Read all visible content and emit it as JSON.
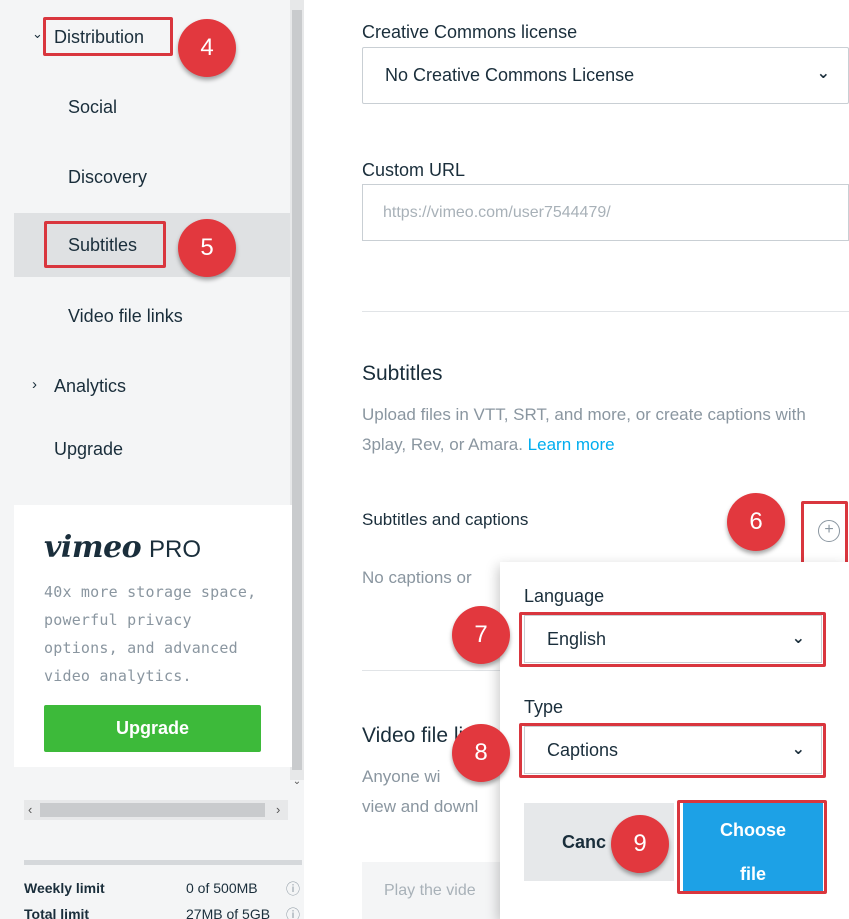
{
  "sidebar": {
    "nav": {
      "distribution": "Distribution",
      "social": "Social",
      "discovery": "Discovery",
      "subtitles": "Subtitles",
      "video_file_links": "Video file links",
      "analytics": "Analytics",
      "upgrade": "Upgrade"
    },
    "pro_card": {
      "logo": "vimeo",
      "tier": "PRO",
      "description": "40x more storage space, powerful privacy options, and advanced video analytics.",
      "button": "Upgrade"
    },
    "limits": [
      {
        "label": "Weekly limit",
        "value": "0 of 500MB"
      },
      {
        "label": "Total limit",
        "value": "27MB of 5GB"
      }
    ]
  },
  "main": {
    "license": {
      "label": "Creative Commons license",
      "value": "No Creative Commons License"
    },
    "custom_url": {
      "label": "Custom URL",
      "placeholder": "https://vimeo.com/user7544479/"
    },
    "subtitles": {
      "title": "Subtitles",
      "description": "Upload files in VTT, SRT, and more, or create captions with 3play, Rev, or Amara.",
      "learn_more": "Learn more",
      "list_label": "Subtitles and captions",
      "empty_text": "No captions or"
    },
    "video_file_links": {
      "title": "Video file li",
      "description_line1": "Anyone wi",
      "description_line2": "view and downl",
      "play_placeholder": "Play the vide"
    }
  },
  "popover": {
    "language_label": "Language",
    "language_value": "English",
    "type_label": "Type",
    "type_value": "Captions",
    "cancel": "Canc",
    "choose_line1": "Choose",
    "choose_line2": "file"
  },
  "callouts": [
    "4",
    "5",
    "6",
    "7",
    "8",
    "9"
  ],
  "colors": {
    "highlight": "#d9363e",
    "badge": "#e2383e",
    "upgrade_green": "#3dba3a",
    "choose_blue": "#1da1e6",
    "link": "#00adef"
  }
}
